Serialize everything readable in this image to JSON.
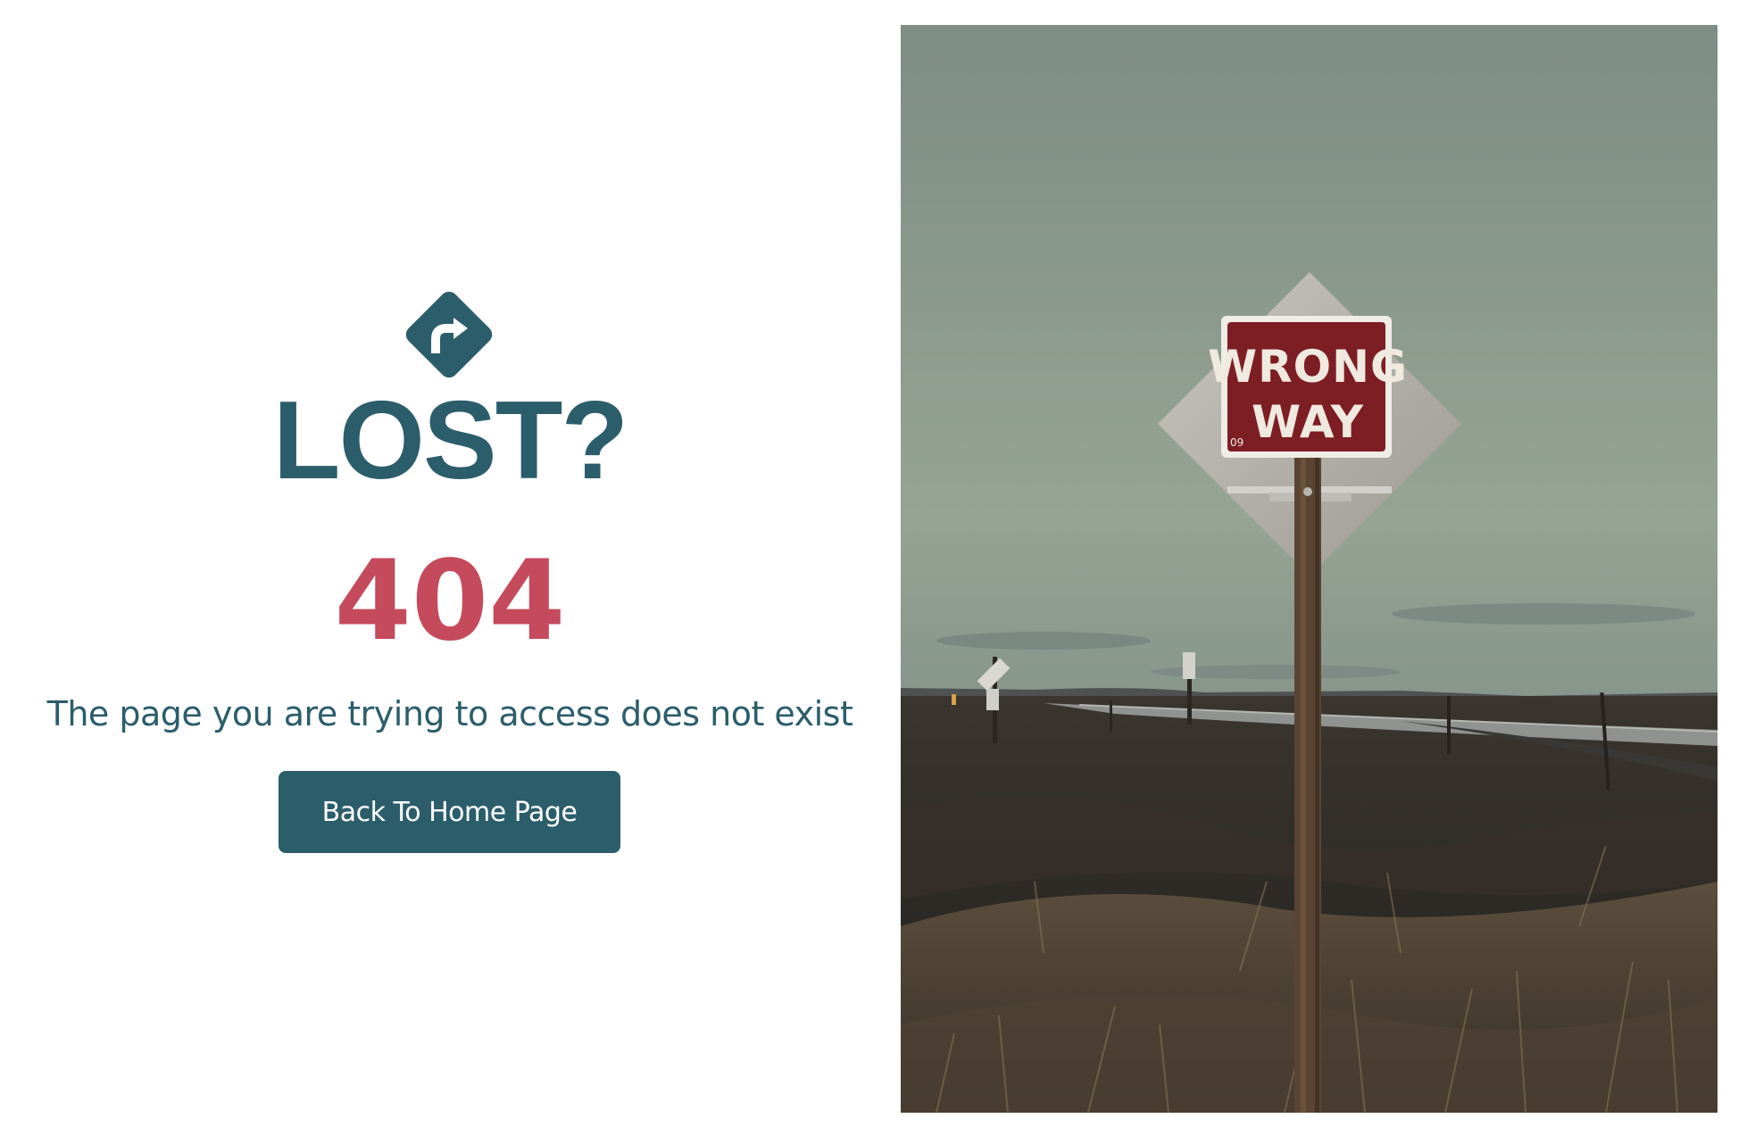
{
  "title": "LOST?",
  "error_code": "404",
  "message": "The page you are trying to access does not exist",
  "button": {
    "label": "Back To Home Page"
  },
  "icons": {
    "sign": "turn-right-road-sign-icon"
  },
  "photo": {
    "sign_line_1": "WRONG",
    "sign_line_2": "WAY",
    "sign_number": "09"
  },
  "colors": {
    "primary": "#2c5d6b",
    "error": "#c54a5c",
    "background": "#ffffff"
  }
}
